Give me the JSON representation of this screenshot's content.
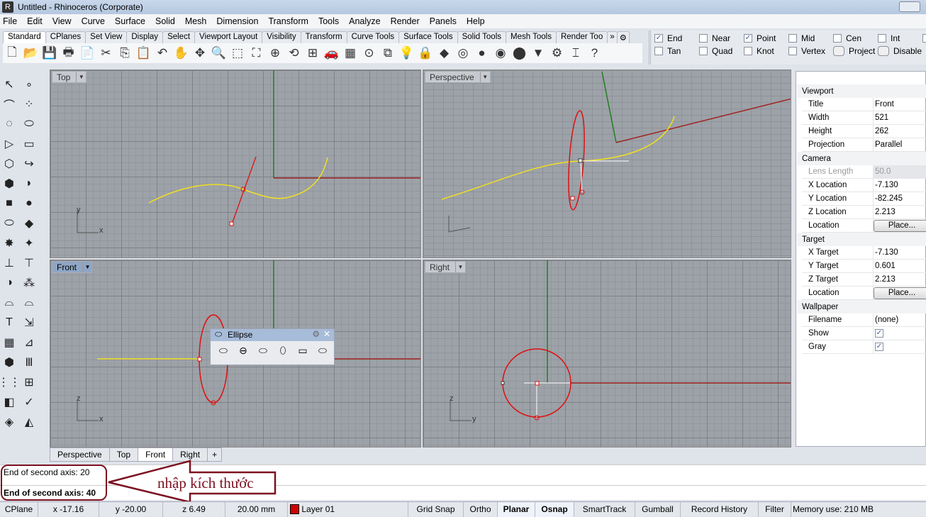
{
  "window": {
    "title": "Untitled - Rhinoceros (Corporate)"
  },
  "menu": [
    "File",
    "Edit",
    "View",
    "Curve",
    "Surface",
    "Solid",
    "Mesh",
    "Dimension",
    "Transform",
    "Tools",
    "Analyze",
    "Render",
    "Panels",
    "Help"
  ],
  "toolbar_tabs": [
    "Standard",
    "CPlanes",
    "Set View",
    "Display",
    "Select",
    "Viewport Layout",
    "Visibility",
    "Transform",
    "Curve Tools",
    "Surface Tools",
    "Solid Tools",
    "Mesh Tools",
    "Render Too"
  ],
  "toolbar_tabs_more": "»",
  "toolbar_icons": [
    {
      "name": "new-icon",
      "g": "🗋"
    },
    {
      "name": "open-icon",
      "g": "📂"
    },
    {
      "name": "save-icon",
      "g": "💾"
    },
    {
      "name": "print-icon",
      "g": "🖶"
    },
    {
      "name": "import-icon",
      "g": "📄"
    },
    {
      "name": "cut-icon",
      "g": "✂"
    },
    {
      "name": "copy-icon",
      "g": "⎘"
    },
    {
      "name": "paste-icon",
      "g": "📋"
    },
    {
      "name": "undo-icon",
      "g": "↶"
    },
    {
      "name": "pan-icon",
      "g": "✋"
    },
    {
      "name": "rotate-view-icon",
      "g": "✥"
    },
    {
      "name": "zoom-icon",
      "g": "🔍"
    },
    {
      "name": "zoom-window-icon",
      "g": "⬚"
    },
    {
      "name": "zoom-extents-icon",
      "g": "⛶"
    },
    {
      "name": "zoom-selected-icon",
      "g": "⊕"
    },
    {
      "name": "undo-view-icon",
      "g": "⟲"
    },
    {
      "name": "four-viewports-icon",
      "g": "⊞"
    },
    {
      "name": "car-icon",
      "g": "🚗"
    },
    {
      "name": "grid-icon",
      "g": "▦"
    },
    {
      "name": "cplane-icon",
      "g": "⊙"
    },
    {
      "name": "select-points-icon",
      "g": "⧉"
    },
    {
      "name": "light-icon",
      "g": "💡"
    },
    {
      "name": "lock-icon",
      "g": "🔒"
    },
    {
      "name": "shaded-icon",
      "g": "◆"
    },
    {
      "name": "color-wheel-icon",
      "g": "◎"
    },
    {
      "name": "render-sphere-icon",
      "g": "●"
    },
    {
      "name": "rendered-sphere-icon",
      "g": "◉"
    },
    {
      "name": "blue-sphere-icon",
      "g": "⬤"
    },
    {
      "name": "material-icon",
      "g": "▼"
    },
    {
      "name": "options-icon",
      "g": "⚙"
    },
    {
      "name": "dimension-icon",
      "g": "⌶"
    },
    {
      "name": "help-icon",
      "g": "?"
    }
  ],
  "osnap": {
    "row1": [
      {
        "label": "End",
        "checked": true
      },
      {
        "label": "Near",
        "checked": false
      },
      {
        "label": "Point",
        "checked": true
      },
      {
        "label": "Mid",
        "checked": false
      },
      {
        "label": "Cen",
        "checked": false
      },
      {
        "label": "Int",
        "checked": false
      }
    ],
    "row2": [
      {
        "label": "Tan",
        "checked": false
      },
      {
        "label": "Quad",
        "checked": false
      },
      {
        "label": "Knot",
        "checked": false
      },
      {
        "label": "Vertex",
        "checked": false
      },
      {
        "label": "Project",
        "checked": false,
        "button": true
      },
      {
        "label": "Disable",
        "checked": false,
        "button": true
      }
    ]
  },
  "left_tools": [
    "↖",
    "∘",
    "⌒",
    "⁘",
    "◌",
    "⬭",
    "▷",
    "▭",
    "⬡",
    "↪",
    "⬢",
    "◗",
    "■",
    "●",
    "⬭",
    "◆",
    "✸",
    "✦",
    "⊥",
    "⊤",
    "◑",
    "⁂",
    "⌓",
    "⌓",
    "T",
    "⇲",
    "▦",
    "⊿",
    "⬢",
    "Ⅲ",
    "⋮⋮",
    "⊞",
    "◧",
    "✓",
    "◈",
    "◭"
  ],
  "viewports": {
    "top": "Top",
    "perspective": "Perspective",
    "front": "Front",
    "right": "Right"
  },
  "axis_labels": {
    "x": "x",
    "y": "y",
    "z": "z"
  },
  "viewport_tabs": [
    "Perspective",
    "Top",
    "Front",
    "Right"
  ],
  "viewport_tab_add": "+",
  "ellipse_panel": {
    "title": "Ellipse",
    "tools": [
      "ellipse-center-icon",
      "ellipse-diameter-icon",
      "ellipse-foci-icon",
      "ellipse-around-curve-icon",
      "ellipse-corner-icon",
      "ellipse-vertical-icon"
    ]
  },
  "properties": {
    "sections": [
      {
        "title": "Viewport",
        "rows": [
          [
            "Title",
            "Front"
          ],
          [
            "Width",
            "521"
          ],
          [
            "Height",
            "262"
          ],
          [
            "Projection",
            "Parallel"
          ]
        ]
      },
      {
        "title": "Camera",
        "rows": [
          [
            "Lens Length",
            "50.0"
          ],
          [
            "X Location",
            "-7.130"
          ],
          [
            "Y Location",
            "-82.245"
          ],
          [
            "Z Location",
            "2.213"
          ],
          [
            "Location",
            "Place..."
          ]
        ]
      },
      {
        "title": "Target",
        "rows": [
          [
            "X Target",
            "-7.130"
          ],
          [
            "Y Target",
            "0.601"
          ],
          [
            "Z Target",
            "2.213"
          ],
          [
            "Location",
            "Place..."
          ]
        ]
      },
      {
        "title": "Wallpaper",
        "rows": [
          [
            "Filename",
            "(none)"
          ],
          [
            "Show",
            "✓"
          ],
          [
            "Gray",
            "✓"
          ]
        ]
      }
    ]
  },
  "command": {
    "history": "End of second axis: 20",
    "prompt": "End of second axis: 40"
  },
  "annotation": {
    "text": "nhập kích thước",
    "color": "#7c1020"
  },
  "status": {
    "cplane": "CPlane",
    "x": "x -17.16",
    "y": "y -20.00",
    "z": "z 6.49",
    "units": "20.00 mm",
    "layer": "Layer 01",
    "layer_color": "#cc0000",
    "toggles": [
      {
        "label": "Grid Snap",
        "on": false
      },
      {
        "label": "Ortho",
        "on": false
      },
      {
        "label": "Planar",
        "on": true
      },
      {
        "label": "Osnap",
        "on": true
      },
      {
        "label": "SmartTrack",
        "on": false
      },
      {
        "label": "Gumball",
        "on": false
      },
      {
        "label": "Record History",
        "on": false
      },
      {
        "label": "Filter",
        "on": false
      }
    ],
    "memory": "Memory use: 210 MB"
  },
  "colors": {
    "curve": "#f0e020",
    "x_axis": "#a02020",
    "y_axis": "#208020",
    "selected": "#dd1111"
  }
}
